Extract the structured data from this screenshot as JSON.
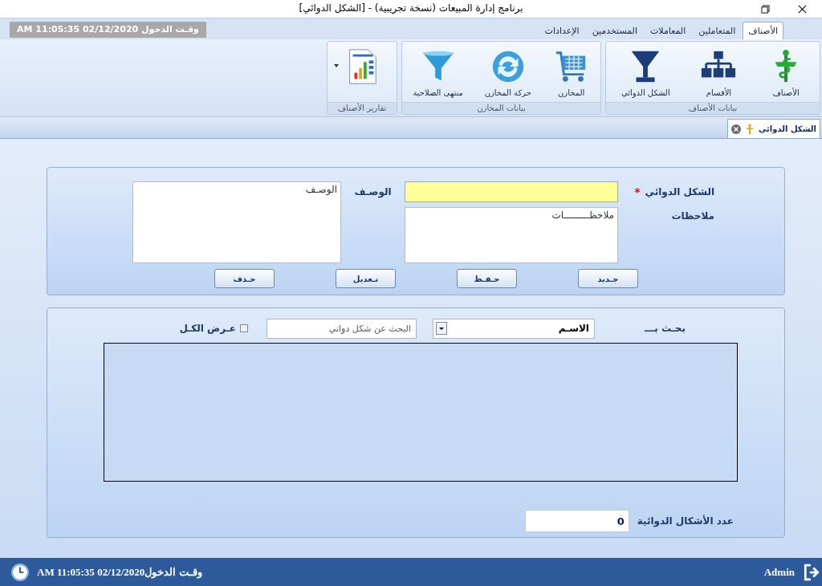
{
  "window": {
    "title": "برنامج إدارة المبيعات (نسخة تجريبية) - [الشكل الدوائي]"
  },
  "login_time": "وقـت الدخول 02/12/2020 11:05:35 AM",
  "menu_tabs": [
    {
      "label": "الأصناف",
      "selected": true
    },
    {
      "label": "المتعاملين",
      "selected": false
    },
    {
      "label": "المعاملات",
      "selected": false
    },
    {
      "label": "المستخدمين",
      "selected": false
    },
    {
      "label": "الإعدادات",
      "selected": false
    }
  ],
  "ribbon_groups": [
    {
      "title": "بيانات الأصناف",
      "items": [
        {
          "label": "الأصناف"
        },
        {
          "label": "الأقسام"
        },
        {
          "label": "الشكل الدوائي"
        }
      ]
    },
    {
      "title": "بيانات المخازن",
      "items": [
        {
          "label": "المخازن"
        },
        {
          "label": "حركة المخازن"
        },
        {
          "label": "منتهى الصلاحية"
        }
      ]
    },
    {
      "title": "تقارير الأصناف",
      "items": [
        {
          "dropdown": true
        }
      ]
    }
  ],
  "document_tabs": [
    {
      "label": "الشكل الدوائي",
      "selected": true
    }
  ],
  "form": {
    "name_label": "الشكل الدوائي",
    "required_mark": "*",
    "desc_label": "الوصـف",
    "desc_value": "الوصـف",
    "notes_label": "ملاحظات",
    "notes_value": "ملاحظـــــــــات",
    "buttons": [
      "جـديد",
      "حـفـظ",
      "تـعديل",
      "حـذف"
    ]
  },
  "search": {
    "label": "بحـث بـــ",
    "search_by": "الاسـم",
    "placeholder": "البحث عن شكل دواني",
    "show_all": {
      "label": "عـرض الكـل",
      "checked": false
    }
  },
  "count": {
    "label": "عدد الأشكال الدوائية",
    "value": "0"
  },
  "status_bar": {
    "user": "Admin",
    "login_time": "وقـت الدخول02/12/2020 11:05:35 AM"
  }
}
